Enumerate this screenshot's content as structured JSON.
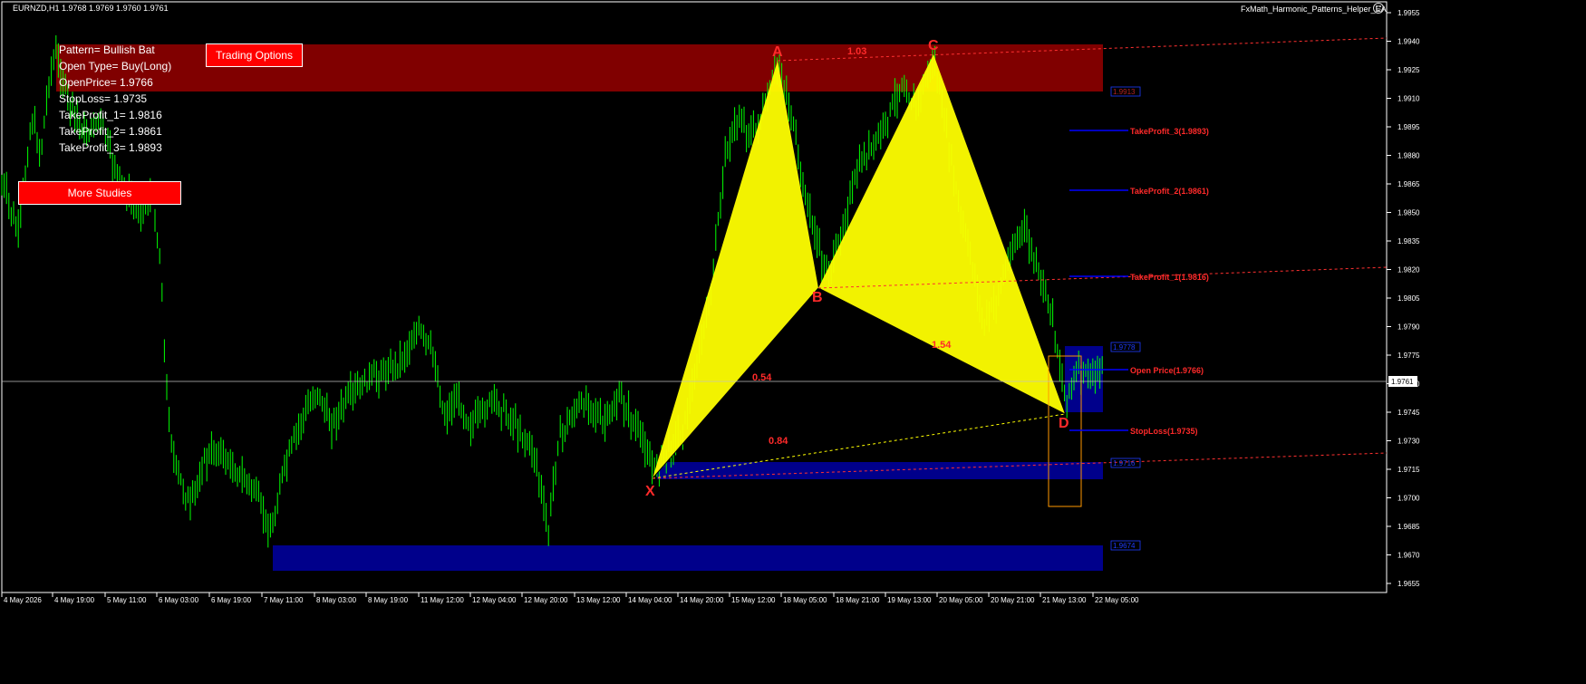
{
  "header": {
    "symbol_ohlc": "EURNZD,H1  1.9768 1.9769 1.9760 1.9761",
    "ea_name": "FxMath_Harmonic_Patterns_Helper_EA",
    "ea_icon": "smiley-icon"
  },
  "info_panel": {
    "lines": [
      "Pattern= Bullish Bat",
      "Open Type= Buy(Long)",
      "OpenPrice= 1.9766",
      "StopLoss= 1.9735",
      "TakeProfit_1= 1.9816",
      "TakeProfit_2= 1.9861",
      "TakeProfit_3= 1.9893"
    ]
  },
  "buttons": {
    "trading_options": "Trading Options",
    "more_studies": "More Studies"
  },
  "pattern": {
    "points": [
      "X",
      "A",
      "B",
      "C",
      "D"
    ],
    "ratios": {
      "ac": "1.03",
      "xb": "0.54",
      "bd": "1.54",
      "xd": "0.84"
    }
  },
  "levels": {
    "tp3": "TakeProfit_3(1.9893)",
    "tp2": "TakeProfit_2(1.9861)",
    "tp1": "TakeProfit_1(1.9816)",
    "open": "Open Price(1.9766)",
    "sl": "StopLoss(1.9735)"
  },
  "zone_labels": {
    "upper": "1.9913",
    "mid": "1.9778",
    "low": "1.9716",
    "bottom": "1.9674"
  },
  "current_price": "1.9761",
  "y_axis_ticks": [
    "1.9955",
    "1.9940",
    "1.9925",
    "1.9910",
    "1.9895",
    "1.9880",
    "1.9865",
    "1.9850",
    "1.9835",
    "1.9820",
    "1.9805",
    "1.9790",
    "1.9775",
    "1.9760",
    "1.9745",
    "1.9730",
    "1.9715",
    "1.9700",
    "1.9685",
    "1.9670",
    "1.9655"
  ],
  "x_axis_ticks": [
    "4 May 2026",
    "4 May 19:00",
    "5 May 11:00",
    "6 May 03:00",
    "6 May 19:00",
    "7 May 11:00",
    "8 May 03:00",
    "8 May 19:00",
    "11 May 12:00",
    "12 May 04:00",
    "12 May 20:00",
    "13 May 12:00",
    "14 May 04:00",
    "14 May 20:00",
    "15 May 12:00",
    "18 May 05:00",
    "18 May 21:00",
    "19 May 13:00",
    "20 May 05:00",
    "20 May 21:00",
    "21 May 13:00",
    "22 May 05:00"
  ],
  "colors": {
    "candle": "#00ff00",
    "pattern_fill": "#ffff00",
    "supply_zone": "#800000",
    "demand_zone": "#00008b",
    "label_red": "#ff2a2a",
    "level_line": "#0000ff",
    "entry_box": "#ff9900"
  }
}
